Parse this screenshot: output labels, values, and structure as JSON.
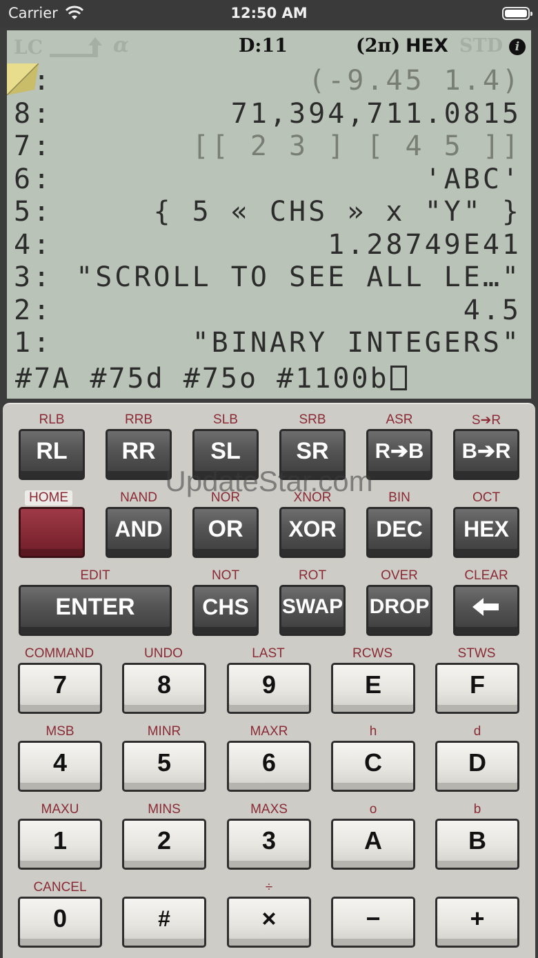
{
  "status_bar": {
    "carrier": "Carrier",
    "time": "12:50 AM"
  },
  "annunciators": {
    "lc": "LC",
    "alpha": "α",
    "depth": "D:11",
    "angle": "(2π)",
    "base": "HEX",
    "mode": "STD",
    "info": "i"
  },
  "stack": [
    {
      "label": "9:",
      "value": "(-9.45 1.4)",
      "dim_value": true
    },
    {
      "label": "8:",
      "value": "71,394,711.0815",
      "dim_value": false
    },
    {
      "label": "7:",
      "value": "[[ 2 3 ] [ 4 5 ]]",
      "dim_value": true
    },
    {
      "label": "6:",
      "value": "'ABC'",
      "dim_value": false
    },
    {
      "label": "5:",
      "value": "{ 5 « CHS » x \"Y\" }",
      "dim_value": false
    },
    {
      "label": "4:",
      "value": "1.28749E41",
      "dim_value": false
    },
    {
      "label": "3:",
      "value": "\"SCROLL TO SEE ALL LE…\"",
      "dim_value": false
    },
    {
      "label": "2:",
      "value": "4.5",
      "dim_value": false
    },
    {
      "label": "1:",
      "value": "\"BINARY INTEGERS\"",
      "dim_value": false
    }
  ],
  "command_line": "#7A #75d #75o #1100b",
  "watermark": "UpdateStar.com",
  "keys": {
    "row1": [
      {
        "shift": "RLB",
        "label": "RL"
      },
      {
        "shift": "RRB",
        "label": "RR"
      },
      {
        "shift": "SLB",
        "label": "SL"
      },
      {
        "shift": "SRB",
        "label": "SR"
      },
      {
        "shift": "ASR",
        "label": "R➔B"
      },
      {
        "shift": "S➔R",
        "label": "B➔R"
      }
    ],
    "row2": [
      {
        "shift": "HOME",
        "label": ""
      },
      {
        "shift": "NAND",
        "label": "AND"
      },
      {
        "shift": "NOR",
        "label": "OR"
      },
      {
        "shift": "XNOR",
        "label": "XOR"
      },
      {
        "shift": "BIN",
        "label": "DEC"
      },
      {
        "shift": "OCT",
        "label": "HEX"
      }
    ],
    "row3": [
      {
        "shift": "EDIT",
        "label": "ENTER"
      },
      {
        "shift": "NOT",
        "label": "CHS"
      },
      {
        "shift": "ROT",
        "label": "SWAP"
      },
      {
        "shift": "OVER",
        "label": "DROP"
      },
      {
        "shift": "CLEAR",
        "label": "🡐"
      }
    ],
    "row4": [
      {
        "shift": "COMMAND",
        "label": "7"
      },
      {
        "shift": "UNDO",
        "label": "8"
      },
      {
        "shift": "LAST",
        "label": "9"
      },
      {
        "shift": "RCWS",
        "label": "E"
      },
      {
        "shift": "STWS",
        "label": "F"
      }
    ],
    "row5": [
      {
        "shift": "MSB",
        "label": "4"
      },
      {
        "shift": "MINR",
        "label": "5"
      },
      {
        "shift": "MAXR",
        "label": "6"
      },
      {
        "shift": "h",
        "label": "C"
      },
      {
        "shift": "d",
        "label": "D"
      }
    ],
    "row6": [
      {
        "shift": "MAXU",
        "label": "1"
      },
      {
        "shift": "MINS",
        "label": "2"
      },
      {
        "shift": "MAXS",
        "label": "3"
      },
      {
        "shift": "o",
        "label": "A"
      },
      {
        "shift": "b",
        "label": "B"
      }
    ],
    "row7": [
      {
        "shift": "CANCEL",
        "label": "0"
      },
      {
        "shift": "",
        "label": "#"
      },
      {
        "shift": "÷",
        "label": "×"
      },
      {
        "shift": "",
        "label": "−"
      },
      {
        "shift": "",
        "label": "+"
      }
    ]
  }
}
